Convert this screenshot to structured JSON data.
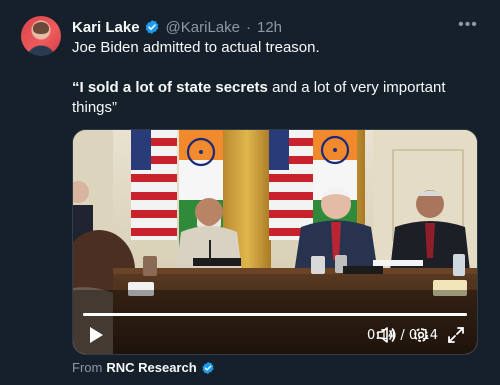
{
  "post": {
    "author_name": "Kari Lake",
    "handle": "@KariLake",
    "separator": "·",
    "time": "12h",
    "text_line1": "Joe Biden admitted to actual treason.",
    "quote_bold": "“I sold a lot of state secrets",
    "quote_rest": " and a lot of very important things”"
  },
  "video": {
    "time_display": "0:14 / 0:14",
    "progress_fraction": 1.0
  },
  "source": {
    "prefix": "From",
    "name": "RNC Research"
  },
  "colors": {
    "background": "#15202b",
    "verified_blue": "#1d9bf0",
    "muted_text": "#8b98a5"
  },
  "icons": [
    "verified-badge-icon",
    "more-options-icon",
    "play-icon",
    "volume-icon",
    "settings-icon",
    "fullscreen-icon"
  ]
}
